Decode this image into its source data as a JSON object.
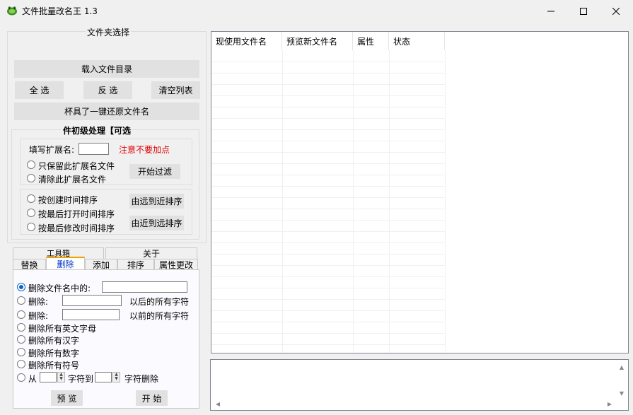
{
  "window": {
    "title": "文件批量改名王  1.3",
    "controls": {
      "minimize": "—",
      "maximize": "☐",
      "close": "✕"
    }
  },
  "folder_group": {
    "title": "文件夹选择",
    "load_button": "载入文件目录",
    "select_all_button": "全  选",
    "invert_button": "反  选",
    "clear_button": "清空列表",
    "restore_button": "杯具了一键还原文件名"
  },
  "filter_group": {
    "title": "件初级处理【可选",
    "ext_label": "填写扩展名:",
    "ext_value": "",
    "warning": "注意不要加点",
    "keep_ext_label": "只保留此扩展名文件",
    "remove_ext_label": "清除此扩展名文件",
    "start_filter_button": "开始过滤",
    "sort_created_label": "按创建时间排序",
    "sort_opened_label": "按最后打开时间排序",
    "sort_modified_label": "按最后修改时间排序",
    "far_to_near_button": "由远到近排序",
    "near_to_far_button": "由近到远排序"
  },
  "top_tabs": [
    "工具箱",
    "关于"
  ],
  "sub_tabs": [
    "替换",
    "删除",
    "添加",
    "排序",
    "属性更改"
  ],
  "selected_sub_tab": "删除",
  "delete_panel": {
    "option1_label": "删除文件名中的:",
    "option2_label": "删除:",
    "option2_suffix": "以后的所有字符",
    "option3_label": "删除:",
    "option3_suffix": "以前的所有字符",
    "option4_label": "删除所有英文字母",
    "option5_label": "删除所有汉字",
    "option6_label": "删除所有数字",
    "option7_label": "删除所有符号",
    "range_from_label": "从",
    "range_to_label": "字符到",
    "range_end_label": "字符删除",
    "preview_button": "预  览",
    "start_button": "开  始",
    "selected_option": 1
  },
  "listview": {
    "columns": [
      "现使用文件名",
      "预览新文件名",
      "属性",
      "状态"
    ]
  },
  "icons": {
    "app": "app-frog-icon",
    "scroll_up": "▲",
    "scroll_down": "▼",
    "scroll_left": "◀",
    "scroll_right": "▶",
    "spin_up": "▲",
    "spin_down": "▼"
  },
  "colors": {
    "warning": "#e00000",
    "selected_tab_text": "#0033cc",
    "selected_tab_accent": "#f0a000",
    "radio_selected": "#0a64c8"
  }
}
